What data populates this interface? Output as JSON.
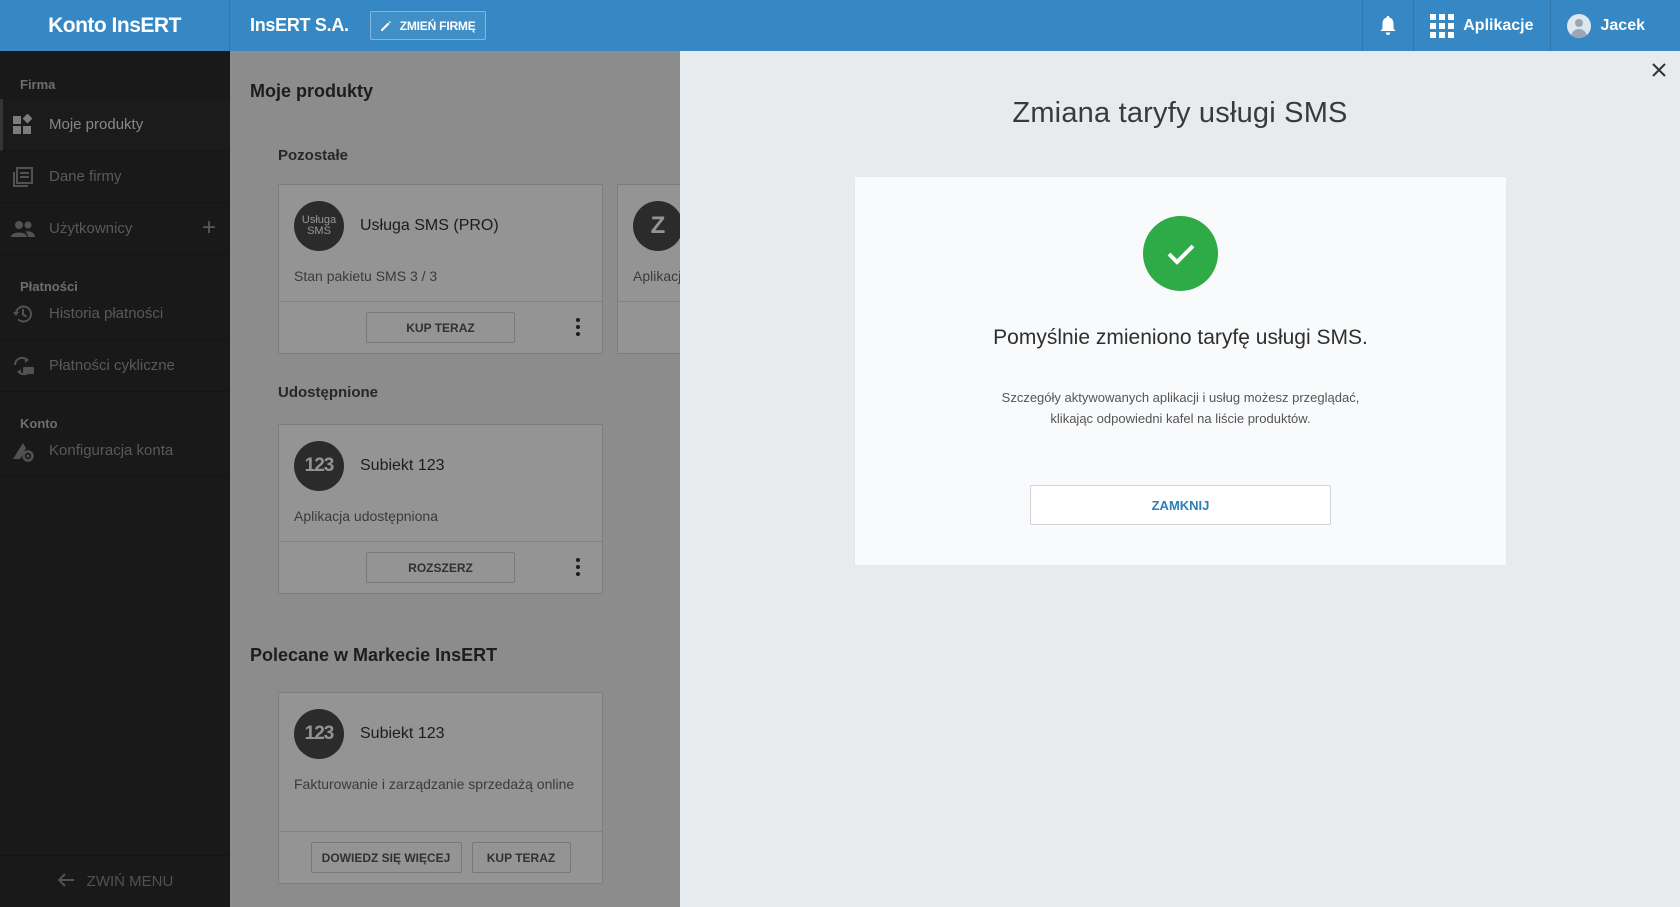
{
  "topbar": {
    "brand": "Konto InsERT",
    "company": "InsERT S.A.",
    "change_company": "ZMIEŃ FIRMĘ",
    "apps_label": "Aplikacje",
    "user_name": "Jacek"
  },
  "sidebar": {
    "sections": {
      "firma": "Firma",
      "platnosci": "Płatności",
      "konto": "Konto"
    },
    "items": {
      "moje_produkty": "Moje produkty",
      "dane_firmy": "Dane firmy",
      "uzytkownicy": "Użytkownicy",
      "historia_platnosci": "Historia płatności",
      "platnosci_cykliczne": "Płatności cykliczne",
      "konfiguracja_konta": "Konfiguracja konta"
    },
    "collapse_label": "ZWIŃ MENU"
  },
  "main": {
    "title": "Moje produkty",
    "section_pozostale": "Pozostałe",
    "section_udostepnione": "Udostępnione",
    "section_polecane": "Polecane w Markecie InsERT",
    "cards": {
      "sms": {
        "logo_line1": "Usługa",
        "logo_line2": "SMS",
        "name": "Usługa SMS (PRO)",
        "desc": "Stan pakietu SMS 3 / 3",
        "button": "KUP TERAZ"
      },
      "partial": {
        "logo": "Z",
        "desc": "Aplikacj"
      },
      "subiekt_shared": {
        "logo": "123",
        "name": "Subiekt 123",
        "desc": "Aplikacja udostępniona",
        "button": "ROZSZERZ"
      },
      "subiekt_market": {
        "logo": "123",
        "name": "Subiekt 123",
        "desc": "Fakturowanie i zarządzanie sprzedażą online",
        "button_more": "DOWIEDZ SIĘ WIĘCEJ",
        "button_buy": "KUP TERAZ"
      }
    }
  },
  "panel": {
    "title": "Zmiana taryfy usługi SMS",
    "heading": "Pomyślnie zmieniono taryfę usługi SMS.",
    "text_line1": "Szczegóły aktywowanych aplikacji i usług możesz przeglądać,",
    "text_line2": "klikając odpowiedni kafel na liście produktów.",
    "close_button": "ZAMKNIJ"
  },
  "colors": {
    "topbar": "#3588c4",
    "sidebar": "#2b2b2b",
    "success": "#2eaa47",
    "link": "#2c7fb8"
  }
}
